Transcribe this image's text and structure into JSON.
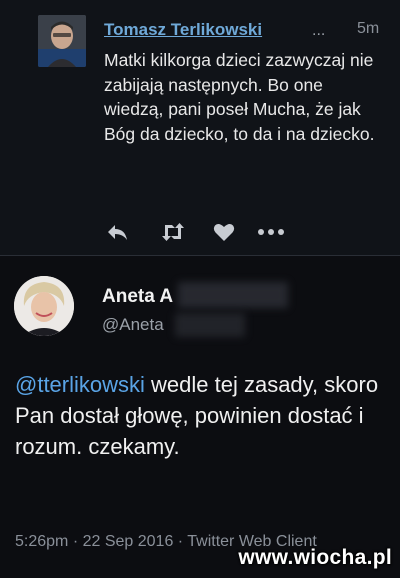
{
  "tweet1": {
    "author": "Tomasz Terlikowski",
    "ellipsis": "...",
    "time": "5m",
    "text": "Matki kilkorga dzieci zazwyczaj nie zabijają następnych. Bo one wiedzą, pani poseł Mucha, że jak Bóg da dziecko, to da i na dziecko.",
    "actions": [
      "reply-icon",
      "retweet-icon",
      "like-icon",
      "more-icon"
    ]
  },
  "tweet2": {
    "author": "Aneta A",
    "handle": "@Aneta",
    "mention": "@tterlikowski",
    "text": " wedle tej zasady, skoro Pan dostał głowę, powinien dostać i rozum. czekamy.",
    "timestamp": "5:26pm · 22 Sep 2016 · Twitter Web Client"
  },
  "watermark": "www.wiocha.pl",
  "colors": {
    "link": "#6fa9d8",
    "mention": "#5aa4e6",
    "background": "#0f0f14",
    "muted": "#8a9099"
  }
}
